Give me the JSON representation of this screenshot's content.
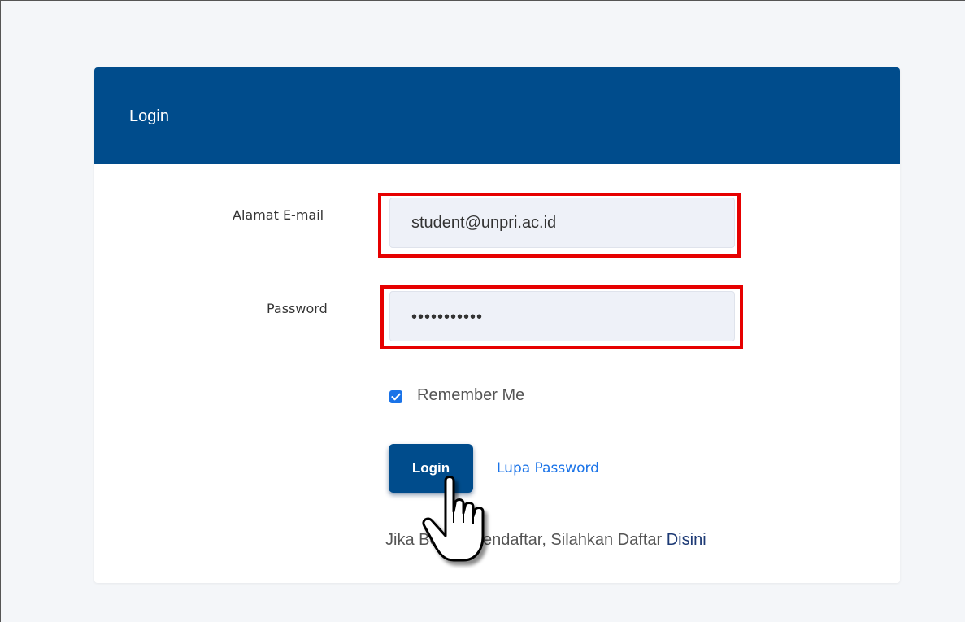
{
  "card": {
    "title": "Login"
  },
  "form": {
    "email_label": "Alamat E-mail",
    "email_value": "student@unpri.ac.id",
    "password_label": "Password",
    "password_value": "•••••••••••",
    "remember_label": "Remember Me",
    "remember_checked": true,
    "login_button": "Login",
    "forgot_link": "Lupa Password",
    "register_prefix": "Jika Belum Mendaftar, Silahkan Daftar ",
    "register_link": "Disini"
  },
  "colors": {
    "header": "#004c8c",
    "highlight": "#e60000",
    "link": "#1a73e8"
  },
  "icons": {
    "cursor": "hand-pointer-icon",
    "checkbox": "check-icon"
  }
}
